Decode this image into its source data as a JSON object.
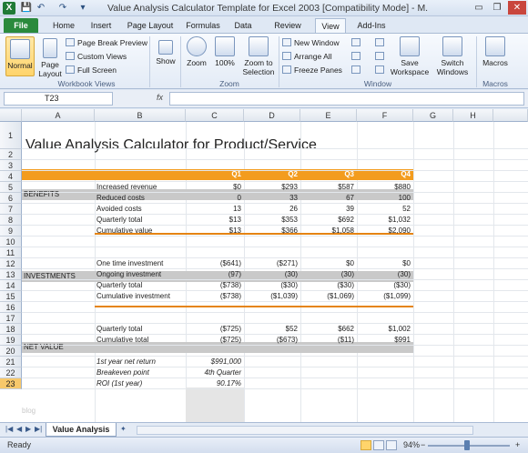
{
  "window": {
    "title": "Value Analysis Calculator Template for Excel 2003  [Compatibility Mode]  -  M.",
    "app_letter": "X",
    "quick_access": [
      "💾",
      "↶",
      "↷",
      "▾"
    ],
    "controls": [
      "▭",
      "❐",
      "✕"
    ]
  },
  "ribbon": {
    "tabs": [
      "File",
      "Home",
      "Insert",
      "Page Layout",
      "Formulas",
      "Data",
      "Review",
      "View",
      "Add-Ins"
    ],
    "active_tab": "View",
    "workbook_views": {
      "group_label": "Workbook Views",
      "normal": "Normal",
      "page_layout": "Page Layout",
      "page_break_preview": "Page Break Preview",
      "custom_views": "Custom Views",
      "full_screen": "Full Screen"
    },
    "show": "Show",
    "zoom": {
      "group_label": "Zoom",
      "zoom": "Zoom",
      "hundred": "100%",
      "zoom_to_selection": "Zoom to Selection"
    },
    "window": {
      "group_label": "Window",
      "new_window": "New Window",
      "arrange_all": "Arrange All",
      "freeze_panes": "Freeze Panes",
      "save_workspace": "Save Workspace",
      "switch_windows": "Switch Windows"
    },
    "macros": {
      "group_label": "Macros",
      "macros": "Macros"
    }
  },
  "formula_bar": {
    "name_box": "T23",
    "fx": "fx",
    "content": ""
  },
  "columns": [
    "A",
    "B",
    "C",
    "D",
    "E",
    "F",
    "G",
    "H"
  ],
  "rows": [
    "1",
    "2",
    "3",
    "4",
    "5",
    "6",
    "7",
    "8",
    "9",
    "10",
    "11",
    "12",
    "13",
    "14",
    "15",
    "16",
    "17",
    "18",
    "19",
    "20",
    "21",
    "22",
    "23"
  ],
  "sheet": {
    "title": "Value Analysis Calculator for Product/Service",
    "quarters": [
      "Q1",
      "Q2",
      "Q3",
      "Q4"
    ],
    "benefits_label": "BENEFITS",
    "benefits": [
      {
        "label": "Increased revenue",
        "values": [
          "$0",
          "$293",
          "$587",
          "$880"
        ]
      },
      {
        "label": "Reduced costs",
        "values": [
          "0",
          "33",
          "67",
          "100"
        ]
      },
      {
        "label": "Avoided costs",
        "values": [
          "13",
          "26",
          "39",
          "52"
        ]
      },
      {
        "label": "Quarterly total",
        "values": [
          "$13",
          "$353",
          "$692",
          "$1,032"
        ]
      },
      {
        "label": "Cumulative value",
        "values": [
          "$13",
          "$366",
          "$1,058",
          "$2,090"
        ]
      }
    ],
    "investments_label": "INVESTMENTS",
    "investments": [
      {
        "label": "One time investment",
        "values": [
          "($641)",
          "($271)",
          "$0",
          "$0"
        ]
      },
      {
        "label": "Ongoing investment",
        "values": [
          "(97)",
          "(30)",
          "(30)",
          "(30)"
        ]
      },
      {
        "label": "Quarterly total",
        "values": [
          "($738)",
          "($30)",
          "($30)",
          "($30)"
        ]
      },
      {
        "label": "Cumulative investment",
        "values": [
          "($738)",
          "($1,039)",
          "($1,069)",
          "($1,099)"
        ]
      }
    ],
    "net_label": "NET VALUE",
    "net": [
      {
        "label": "Quarterly total",
        "values": [
          "($725)",
          "$52",
          "$662",
          "$1,002"
        ]
      },
      {
        "label": "Cumulative total",
        "values": [
          "($725)",
          "($673)",
          "($11)",
          "$991"
        ]
      }
    ],
    "summary": [
      {
        "label": "1st year net return",
        "value": "$991,000"
      },
      {
        "label": "Breakeven point",
        "value": "4th Quarter"
      },
      {
        "label": "ROI (1st year)",
        "value": "90.17%"
      }
    ],
    "watermark": "blog"
  },
  "sheet_tabs": [
    "Value Analysis"
  ],
  "status": {
    "ready": "Ready",
    "zoom": "94%",
    "zoom_minus": "−",
    "zoom_plus": "+"
  },
  "colors": {
    "header_orange": "#f39c1e",
    "section_gray": "#c9c9c9",
    "file_tab": "#2a8a3c"
  }
}
